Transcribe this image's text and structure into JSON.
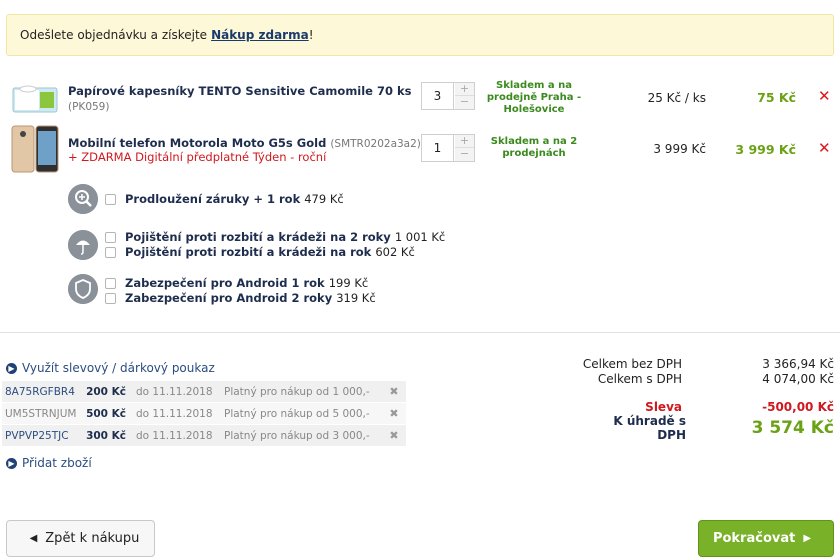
{
  "promo": {
    "text": "Odešlete objednávku a získejte",
    "link": "Nákup zdarma",
    "suffix": "!"
  },
  "items": [
    {
      "name": "Papírové kapesníky TENTO Sensitive Camomile 70 ks",
      "code": "(PK059)",
      "note": "",
      "qty": "3",
      "stock": "Skladem a na prodejně Praha - Holešovice",
      "unit_price": "25 Kč / ks",
      "total": "75 Kč"
    },
    {
      "name": "Mobilní telefon Motorola Moto G5s Gold",
      "code": "(SMTR0202a3a2)",
      "note": "+ ZDARMA Digitální předplatné Týden - roční",
      "qty": "1",
      "stock": "Skladem a na 2 prodejnách",
      "unit_price": "3 999 Kč",
      "total": "3 999 Kč"
    }
  ],
  "services": [
    {
      "icon": "magnifier-plus-icon",
      "options": [
        {
          "label": "Prodloužení záruky + 1 rok",
          "price": "479 Kč"
        }
      ]
    },
    {
      "icon": "umbrella-icon",
      "options": [
        {
          "label": "Pojištění proti rozbití a krádeži na 2 roky",
          "price": "1 001 Kč"
        },
        {
          "label": "Pojištění proti rozbití a krádeži na rok",
          "price": "602 Kč"
        }
      ]
    },
    {
      "icon": "shield-icon",
      "options": [
        {
          "label": "Zabezpečení pro Android 1 rok",
          "price": "199 Kč"
        },
        {
          "label": "Zabezpečení pro Android 2 roky",
          "price": "319 Kč"
        }
      ]
    }
  ],
  "voucher_link": "Využít slevový / dárkový poukaz",
  "vouchers": [
    {
      "code": "8A75RGFBR4",
      "amount": "200 Kč",
      "valid": "do 11.11.2018",
      "condition": "Platný pro nákup od 1 000,-"
    },
    {
      "code": "UM5STRNJUM",
      "amount": "500 Kč",
      "valid": "do 11.11.2018",
      "condition": "Platný pro nákup od 5 000,-"
    },
    {
      "code": "PVPVP25TJC",
      "amount": "300 Kč",
      "valid": "do 11.11.2018",
      "condition": "Platný pro nákup od 3 000,-"
    }
  ],
  "add_link": "Přidat zboží",
  "summary": {
    "net_label": "Celkem bez DPH",
    "net": "3 366,94 Kč",
    "gross_label": "Celkem s DPH",
    "gross": "4 074,00 Kč",
    "discount_label": "Sleva",
    "discount": "-500,00 Kč",
    "pay_label": "K úhradě s DPH",
    "pay": "3 574 Kč"
  },
  "buttons": {
    "back": "Zpět k nákupu",
    "next": "Pokračovat"
  },
  "colors": {
    "price_green": "#6aa214",
    "stock_green": "#3a8a1e",
    "delete_red": "#e0161e",
    "button_green": "#79b128",
    "promo_bg": "#fdf8d7"
  }
}
